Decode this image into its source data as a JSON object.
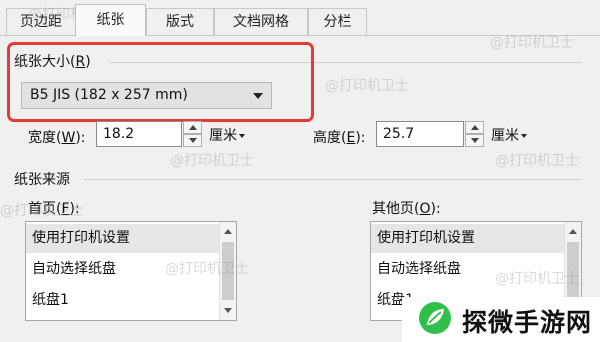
{
  "tabs": [
    {
      "label": "页边距",
      "active": false
    },
    {
      "label": "纸张",
      "active": true
    },
    {
      "label": "版式",
      "active": false
    },
    {
      "label": "文档网格",
      "active": false
    },
    {
      "label": "分栏",
      "active": false
    }
  ],
  "paper_size": {
    "title": "纸张大小",
    "hotkey": "R",
    "selected": "B5 JIS (182 x 257 mm)"
  },
  "width": {
    "label": "宽度",
    "hotkey": "W",
    "value": "18.2",
    "unit": "厘米"
  },
  "height": {
    "label": "高度",
    "hotkey": "E",
    "value": "25.7",
    "unit": "厘米"
  },
  "paper_source": {
    "title": "纸张来源",
    "first_page": {
      "label": "首页",
      "hotkey": "F",
      "items": [
        "使用打印机设置",
        "自动选择纸盘",
        "纸盘1"
      ],
      "selected_index": 0
    },
    "other_pages": {
      "label": "其他页",
      "hotkey": "O",
      "items": [
        "使用打印机设置",
        "自动选择纸盘",
        "纸盘1"
      ],
      "selected_index": 0
    }
  },
  "watermark_text": "@打印机卫士",
  "logo_text": "探微手游网",
  "colors": {
    "highlight_border": "#e53935",
    "logo_green": "#2fbf4a"
  }
}
